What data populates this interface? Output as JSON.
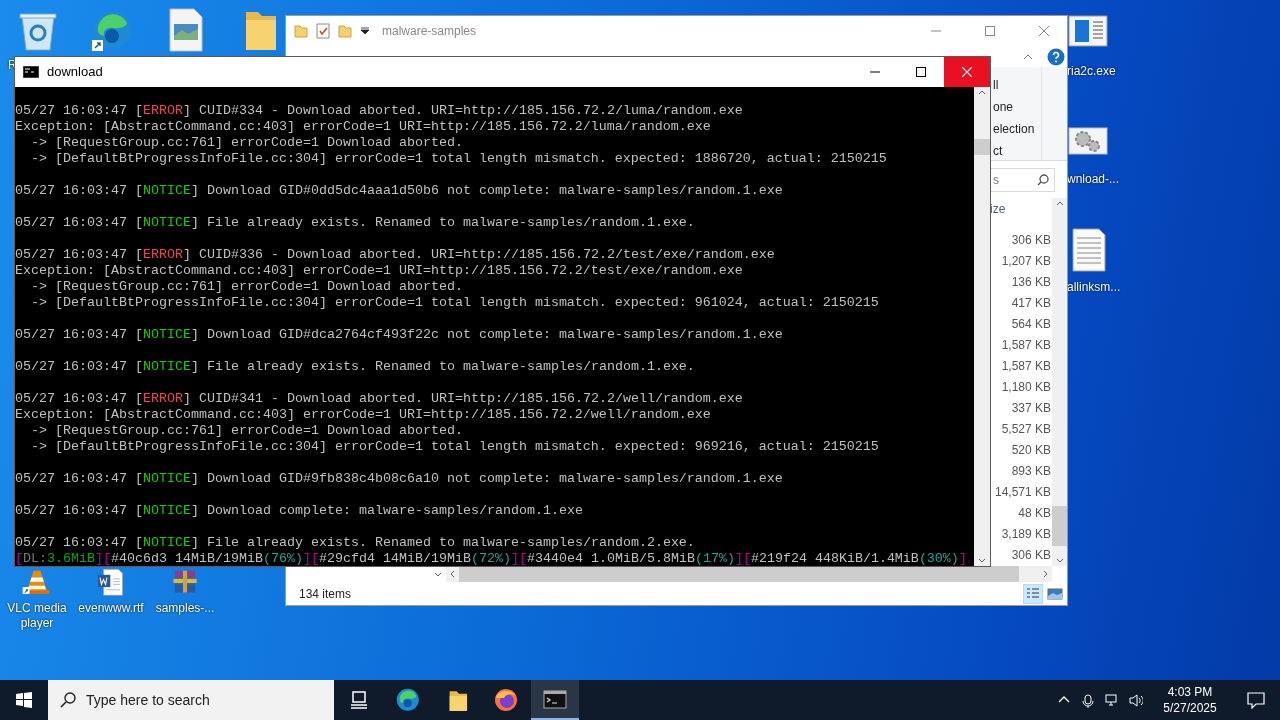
{
  "desktop": {
    "top_icons": [
      {
        "kind": "recycle",
        "label": "R"
      },
      {
        "kind": "edge"
      },
      {
        "kind": "image"
      },
      {
        "kind": "folder"
      }
    ],
    "right_icons": [
      {
        "kind": "app",
        "label": "ria2c.exe"
      },
      {
        "kind": "gears",
        "label": "wnload-..."
      },
      {
        "kind": "textfile",
        "label": "allinksm..."
      }
    ],
    "bottom_icons": [
      {
        "kind": "vlc",
        "label": "VLC media player"
      },
      {
        "kind": "word",
        "label": "evenwww.rtf"
      },
      {
        "kind": "archive",
        "label": "samples-..."
      }
    ]
  },
  "explorer": {
    "title": "malware-samples",
    "ribbon_fragments": [
      "ll",
      "one",
      "election",
      "ct"
    ],
    "search": {
      "placeholder": "s"
    },
    "size_header": "ize",
    "sizes": [
      "306 KB",
      "1,207 KB",
      "136 KB",
      "417 KB",
      "564 KB",
      "1,587 KB",
      "1,587 KB",
      "1,180 KB",
      "337 KB",
      "5,527 KB",
      "520 KB",
      "893 KB",
      "14,571 KB",
      "48 KB",
      "3,189 KB",
      "306 KB"
    ],
    "status": "134 items"
  },
  "console": {
    "title": "download",
    "entries": [
      {
        "lines": [
          [
            {
              "kind": "plain",
              "text": "05/27 16:03:47 ["
            },
            {
              "kind": "error",
              "text": "ERROR"
            },
            {
              "kind": "plain",
              "text": "] CUID#334 - Download aborted. URI=http://185.156.72.2/luma/random.exe"
            }
          ],
          [
            {
              "kind": "plain",
              "text": "Exception: [AbstractCommand.cc:403] errorCode=1 URI=http://185.156.72.2/luma/random.exe"
            }
          ],
          [
            {
              "kind": "plain",
              "text": "  -> [RequestGroup.cc:761] errorCode=1 Download aborted."
            }
          ],
          [
            {
              "kind": "plain",
              "text": "  -> [DefaultBtProgressInfoFile.cc:304] errorCode=1 total length mismatch. expected: 1886720, actual: 2150215"
            }
          ]
        ]
      },
      {
        "lines": [
          [
            {
              "kind": "plain",
              "text": "05/27 16:03:47 ["
            },
            {
              "kind": "notice",
              "text": "NOTICE"
            },
            {
              "kind": "plain",
              "text": "] Download GID#0dd5dc4aaa1d50b6 not complete: malware-samples/random.1.exe"
            }
          ]
        ]
      },
      {
        "lines": [
          [
            {
              "kind": "plain",
              "text": "05/27 16:03:47 ["
            },
            {
              "kind": "notice",
              "text": "NOTICE"
            },
            {
              "kind": "plain",
              "text": "] File already exists. Renamed to malware-samples/random.1.exe."
            }
          ]
        ]
      },
      {
        "lines": [
          [
            {
              "kind": "plain",
              "text": "05/27 16:03:47 ["
            },
            {
              "kind": "error",
              "text": "ERROR"
            },
            {
              "kind": "plain",
              "text": "] CUID#336 - Download aborted. URI=http://185.156.72.2/test/exe/random.exe"
            }
          ],
          [
            {
              "kind": "plain",
              "text": "Exception: [AbstractCommand.cc:403] errorCode=1 URI=http://185.156.72.2/test/exe/random.exe"
            }
          ],
          [
            {
              "kind": "plain",
              "text": "  -> [RequestGroup.cc:761] errorCode=1 Download aborted."
            }
          ],
          [
            {
              "kind": "plain",
              "text": "  -> [DefaultBtProgressInfoFile.cc:304] errorCode=1 total length mismatch. expected: 961024, actual: 2150215"
            }
          ]
        ]
      },
      {
        "lines": [
          [
            {
              "kind": "plain",
              "text": "05/27 16:03:47 ["
            },
            {
              "kind": "notice",
              "text": "NOTICE"
            },
            {
              "kind": "plain",
              "text": "] Download GID#dca2764cf493f22c not complete: malware-samples/random.1.exe"
            }
          ]
        ]
      },
      {
        "lines": [
          [
            {
              "kind": "plain",
              "text": "05/27 16:03:47 ["
            },
            {
              "kind": "notice",
              "text": "NOTICE"
            },
            {
              "kind": "plain",
              "text": "] File already exists. Renamed to malware-samples/random.1.exe."
            }
          ]
        ]
      },
      {
        "lines": [
          [
            {
              "kind": "plain",
              "text": "05/27 16:03:47 ["
            },
            {
              "kind": "error",
              "text": "ERROR"
            },
            {
              "kind": "plain",
              "text": "] CUID#341 - Download aborted. URI=http://185.156.72.2/well/random.exe"
            }
          ],
          [
            {
              "kind": "plain",
              "text": "Exception: [AbstractCommand.cc:403] errorCode=1 URI=http://185.156.72.2/well/random.exe"
            }
          ],
          [
            {
              "kind": "plain",
              "text": "  -> [RequestGroup.cc:761] errorCode=1 Download aborted."
            }
          ],
          [
            {
              "kind": "plain",
              "text": "  -> [DefaultBtProgressInfoFile.cc:304] errorCode=1 total length mismatch. expected: 969216, actual: 2150215"
            }
          ]
        ]
      },
      {
        "lines": [
          [
            {
              "kind": "plain",
              "text": "05/27 16:03:47 ["
            },
            {
              "kind": "notice",
              "text": "NOTICE"
            },
            {
              "kind": "plain",
              "text": "] Download GID#9fb838c4b08c6a10 not complete: malware-samples/random.1.exe"
            }
          ]
        ]
      },
      {
        "lines": [
          [
            {
              "kind": "plain",
              "text": "05/27 16:03:47 ["
            },
            {
              "kind": "notice",
              "text": "NOTICE"
            },
            {
              "kind": "plain",
              "text": "] Download complete: malware-samples/random.1.exe"
            }
          ]
        ]
      },
      {
        "lines": [
          [
            {
              "kind": "plain",
              "text": "05/27 16:03:47 ["
            },
            {
              "kind": "notice",
              "text": "NOTICE"
            },
            {
              "kind": "plain",
              "text": "] File already exists. Renamed to malware-samples/random.2.exe."
            }
          ]
        ]
      }
    ],
    "status_line": [
      {
        "kind": "bracket",
        "text": "["
      },
      {
        "kind": "dim",
        "text": "DL:"
      },
      {
        "kind": "speed",
        "text": "3.6MiB"
      },
      {
        "kind": "bracket",
        "text": "]["
      },
      {
        "kind": "plain",
        "text": "#40c6d3 14MiB/19MiB"
      },
      {
        "kind": "pct",
        "text": "(76%)"
      },
      {
        "kind": "bracket",
        "text": "]["
      },
      {
        "kind": "plain",
        "text": "#29cfd4 14MiB/19MiB"
      },
      {
        "kind": "pct",
        "text": "(72%)"
      },
      {
        "kind": "bracket",
        "text": "]["
      },
      {
        "kind": "plain",
        "text": "#3440e4 1.0MiB/5.8MiB"
      },
      {
        "kind": "pct",
        "text": "(17%)"
      },
      {
        "kind": "bracket",
        "text": "]["
      },
      {
        "kind": "plain",
        "text": "#219f24 448KiB/1.4MiB"
      },
      {
        "kind": "pct",
        "text": "(30%)"
      },
      {
        "kind": "bracket",
        "text": "]"
      }
    ]
  },
  "taskbar": {
    "search": {
      "placeholder": "Type here to search"
    },
    "apps": [
      {
        "kind": "taskview",
        "active": false
      },
      {
        "kind": "edge",
        "active": false
      },
      {
        "kind": "folder",
        "active": false
      },
      {
        "kind": "firefox",
        "active": false
      },
      {
        "kind": "console",
        "active": true
      }
    ],
    "clock": {
      "time": "4:03 PM",
      "date": "5/27/2025"
    }
  }
}
